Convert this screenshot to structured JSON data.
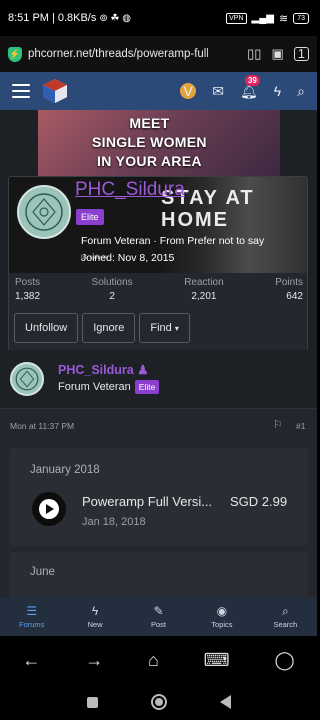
{
  "status_bar": {
    "time": "8:51 PM",
    "speed": "0.8KB/s",
    "vpn": "VPN",
    "battery": "73"
  },
  "browser": {
    "url": "phcorner.net/threads/poweramp-full-versic",
    "tab_count": "1"
  },
  "site_header": {
    "avatar_letter": "V",
    "alerts_count": "39"
  },
  "ad_banner": {
    "line1": "MEET",
    "line2": "SINGLE WOMEN",
    "line3": "IN YOUR AREA"
  },
  "member_tooltip": {
    "username": "PHC_Sildura",
    "badge": "Elite",
    "banner_text": "STAY AT HOME",
    "banner_caption": "be safe in",
    "title_line": "Forum Veteran · From Prefer not to say",
    "joined": "Joined: Nov 8, 2015",
    "stats": [
      {
        "label": "Posts",
        "value": "1,382"
      },
      {
        "label": "Solutions",
        "value": "2"
      },
      {
        "label": "Reaction",
        "value": "2,201"
      },
      {
        "label": "Points",
        "value": "642"
      }
    ],
    "actions": {
      "unfollow": "Unfollow",
      "ignore": "Ignore",
      "find": "Find"
    }
  },
  "post": {
    "username": "PHC_Sildura",
    "user_title": "Forum Veteran",
    "badge": "Elite",
    "date": "Mon at 11:37 PM",
    "number": "#1"
  },
  "embed": {
    "section1": "January 2018",
    "item_title": "Poweramp Full Versi...",
    "item_price": "SGD 2.99",
    "item_date": "Jan 18, 2018",
    "section2": "June"
  },
  "forum_nav": [
    {
      "label": "Forums",
      "icon": "forums-icon",
      "glyph": "☰"
    },
    {
      "label": "New",
      "icon": "lightning-icon",
      "glyph": "ϟ"
    },
    {
      "label": "Post",
      "icon": "post-icon",
      "glyph": "✎"
    },
    {
      "label": "Topics",
      "icon": "fire-icon",
      "glyph": "◉"
    },
    {
      "label": "Search",
      "icon": "search-icon",
      "glyph": "⌕"
    }
  ],
  "colors": {
    "header_blue": "#2c4a78",
    "username_purple": "#9b59d6",
    "elite_badge": "#8a3fd1",
    "nav_active": "#5aa0ec"
  }
}
